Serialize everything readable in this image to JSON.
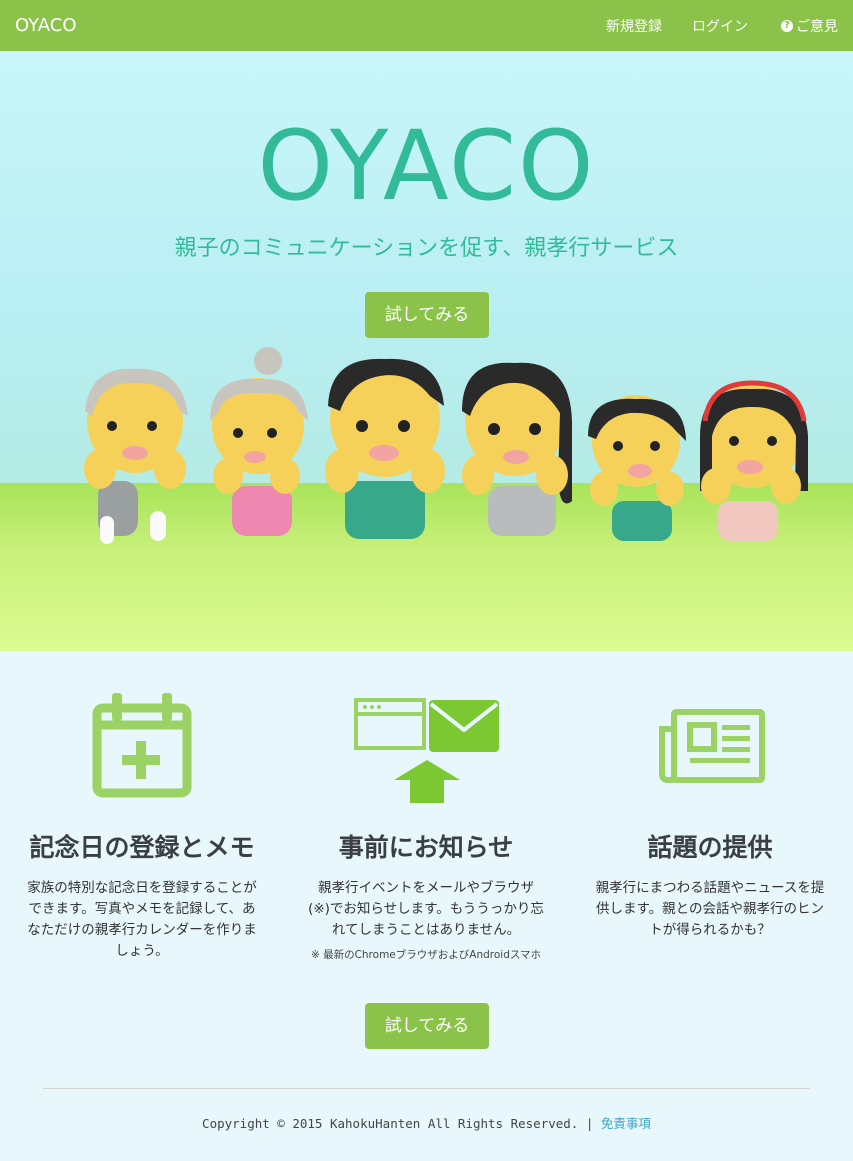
{
  "navbar": {
    "brand": "OYACO",
    "links": {
      "register": "新規登録",
      "login": "ログイン",
      "feedback": "ご意見"
    },
    "bg_color": "#8bc34a"
  },
  "hero": {
    "title": "OYACO",
    "subtitle": "親子のコミュニケーションを促す、親孝行サービス",
    "cta_label": "試してみる",
    "title_color": "#33bb99"
  },
  "features": {
    "items": [
      {
        "icon": "calendar-plus-icon",
        "title": "記念日の登録とメモ",
        "desc": "家族の特別な記念日を登録することができます。写真やメモを記録して、あなただけの親孝行カレンダーを作りましょう。"
      },
      {
        "icon": "browser-mail-icon",
        "title": "事前にお知らせ",
        "desc": "親孝行イベントをメールやブラウザ(※)でお知らせします。もううっかり忘れてしまうことはありません。",
        "note": "※ 最新のChromeブラウザおよびAndroidスマホ"
      },
      {
        "icon": "newspaper-icon",
        "title": "話題の提供",
        "desc": "親孝行にまつわる話題やニュースを提供します。親との会話や親孝行のヒントが得られるかも？"
      }
    ],
    "cta_label": "試してみる",
    "icon_color": "#9ad364"
  },
  "footer": {
    "copyright": "Copyright © 2015 KahokuHanten All Rights Reserved. |",
    "disclaimer_link": "免責事項"
  }
}
